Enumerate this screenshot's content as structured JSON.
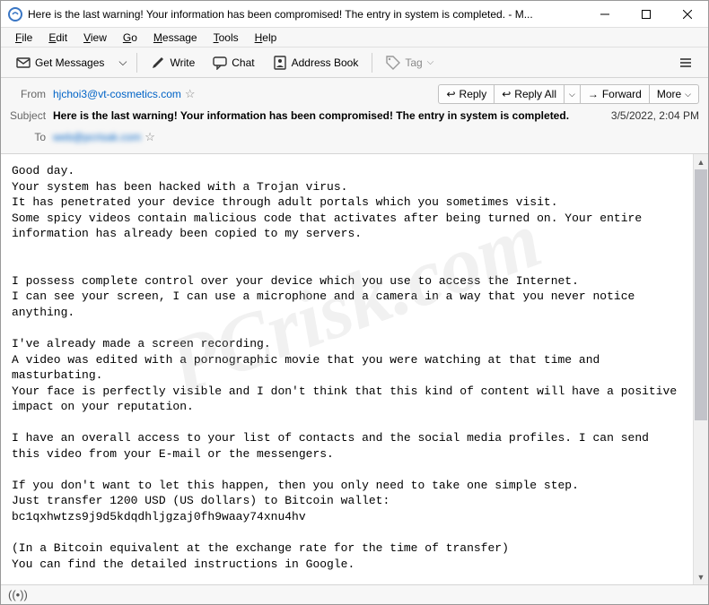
{
  "titlebar": {
    "text": "Here is the last warning! Your information has been compromised! The entry in system is completed. - M..."
  },
  "menubar": {
    "file": "File",
    "edit": "Edit",
    "view": "View",
    "go": "Go",
    "message": "Message",
    "tools": "Tools",
    "help": "Help"
  },
  "toolbar": {
    "get_messages": "Get Messages",
    "write": "Write",
    "chat": "Chat",
    "address_book": "Address Book",
    "tag": "Tag"
  },
  "header": {
    "from_label": "From",
    "from_value": "hjchoi3@vt-cosmetics.com",
    "subject_label": "Subject",
    "subject_value": "Here is the last warning! Your information has been compromised! The entry in system is completed.",
    "to_label": "To",
    "to_value": "web@pcrisak.com",
    "date": "3/5/2022, 2:04 PM",
    "reply": "Reply",
    "reply_all": "Reply All",
    "forward": "Forward",
    "more": "More"
  },
  "body": {
    "text": "Good day.\nYour system has been hacked with a Trojan virus.\nIt has penetrated your device through adult portals which you sometimes visit.\nSome spicy videos contain malicious code that activates after being turned on. Your entire information has already been copied to my servers.\n\n\nI possess complete control over your device which you use to access the Internet.\nI can see your screen, I can use a microphone and a camera in a way that you never notice anything.\n\nI've already made a screen recording.\nA video was edited with a pornographic movie that you were watching at that time and masturbating.\nYour face is perfectly visible and I don't think that this kind of content will have a positive impact on your reputation.\n\nI have an overall access to your list of contacts and the social media profiles. I can send this video from your E-mail or the messengers.\n\nIf you don't want to let this happen, then you only need to take one simple step.\nJust transfer 1200 USD (US dollars) to Bitcoin wallet: bc1qxhwtzs9j9d5kdqdhljgzaj0fh9waay74xnu4hv\n\n(In a Bitcoin equivalent at the exchange rate for the time of transfer)\nYou can find the detailed instructions in Google."
  },
  "statusbar": {
    "remote_icon": "((•))"
  },
  "watermark": "PCrisk.com"
}
